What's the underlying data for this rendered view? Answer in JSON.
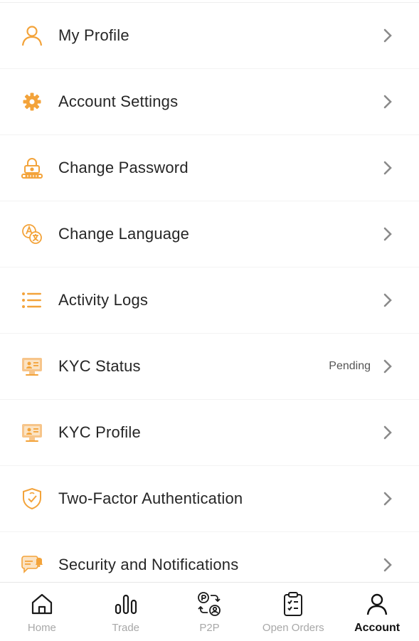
{
  "colors": {
    "accent": "#F3A33A",
    "text": "#262626",
    "chevron": "#8a8a8a",
    "tab_inactive": "#a8a8a8",
    "tab_active": "#111111"
  },
  "menu": {
    "items": [
      {
        "label": "My Profile",
        "icon": "user-icon"
      },
      {
        "label": "Account Settings",
        "icon": "gear-icon"
      },
      {
        "label": "Change Password",
        "icon": "lock-icon"
      },
      {
        "label": "Change Language",
        "icon": "language-icon"
      },
      {
        "label": "Activity Logs",
        "icon": "list-icon"
      },
      {
        "label": "KYC Status",
        "icon": "kyc-monitor-icon",
        "badge": "Pending"
      },
      {
        "label": "KYC Profile",
        "icon": "kyc-monitor-icon"
      },
      {
        "label": "Two-Factor Authentication",
        "icon": "shield-icon"
      },
      {
        "label": "Security and Notifications",
        "icon": "chat-bell-icon"
      }
    ]
  },
  "tabbar": {
    "tabs": [
      {
        "label": "Home",
        "icon": "home-icon"
      },
      {
        "label": "Trade",
        "icon": "chart-bars-icon"
      },
      {
        "label": "P2P",
        "icon": "p2p-icon"
      },
      {
        "label": "Open Orders",
        "icon": "clipboard-icon"
      },
      {
        "label": "Account",
        "icon": "account-icon",
        "active": true
      }
    ]
  }
}
